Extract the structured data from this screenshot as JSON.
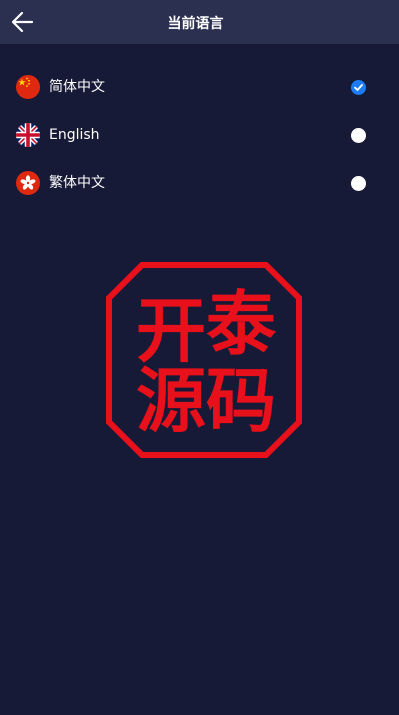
{
  "header": {
    "title": "当前语言",
    "back_icon": "arrow-left-icon"
  },
  "languages": [
    {
      "label": "简体中文",
      "flag": "china-flag-icon",
      "selected": true
    },
    {
      "label": "English",
      "flag": "uk-flag-icon",
      "selected": false
    },
    {
      "label": "繁体中文",
      "flag": "hongkong-flag-icon",
      "selected": false
    }
  ],
  "watermark": {
    "text": "开泰源码",
    "color": "#e8101a"
  },
  "colors": {
    "background": "#161a36",
    "header": "#2b3050",
    "accent": "#1c7cf3"
  }
}
